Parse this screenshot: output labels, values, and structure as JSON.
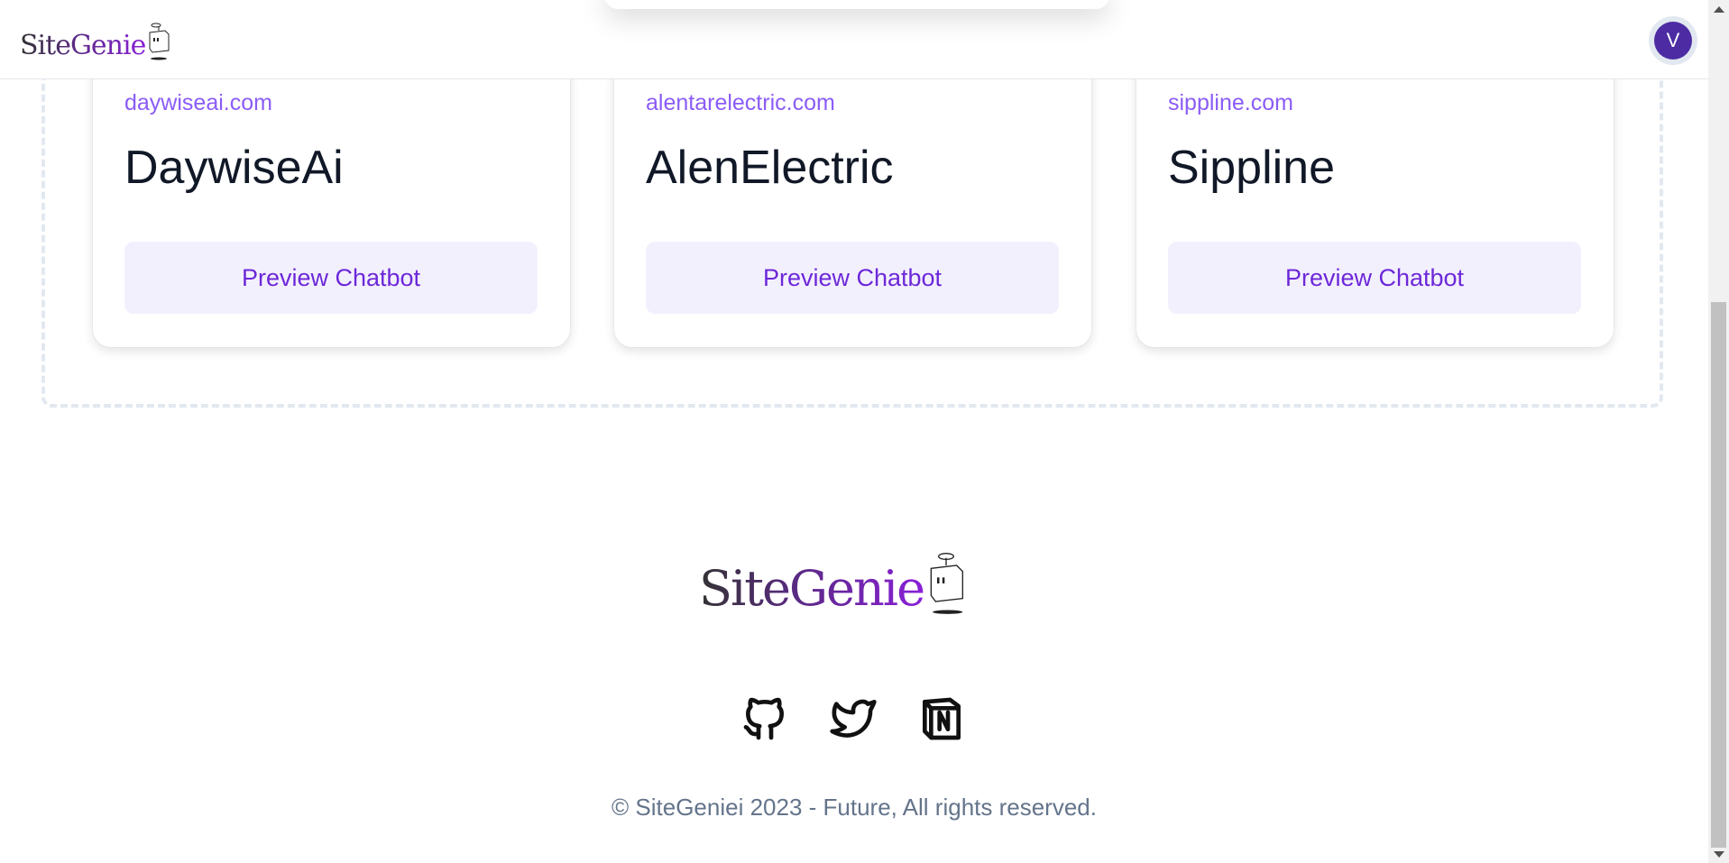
{
  "header": {
    "logo_text": "SiteGenie",
    "avatar_initial": "V"
  },
  "cards": [
    {
      "domain": "daywiseai.com",
      "title": "DaywiseAi",
      "button": "Preview Chatbot"
    },
    {
      "domain": "alentarelectric.com",
      "title": "AlenElectric",
      "button": "Preview Chatbot"
    },
    {
      "domain": "sippline.com",
      "title": "Sippline",
      "button": "Preview Chatbot"
    }
  ],
  "footer": {
    "logo_text": "SiteGenie",
    "social": [
      "github-icon",
      "twitter-icon",
      "notion-icon"
    ],
    "copyright": "© SiteGeniei 2023 - Future, All rights reserved."
  }
}
